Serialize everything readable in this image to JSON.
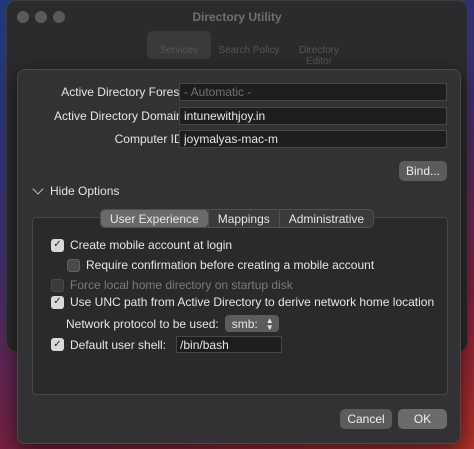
{
  "background_window": {
    "title": "Directory Utility",
    "toolbar": [
      "Services",
      "Search Policy",
      "Directory Editor"
    ]
  },
  "form": {
    "forest_label": "Active Directory Forest:",
    "forest_placeholder": "- Automatic -",
    "domain_label": "Active Directory Domain:",
    "domain_value": "intunewithjoy.in",
    "computer_label": "Computer ID:",
    "computer_value": "joymalyas-mac-m",
    "bind_button": "Bind..."
  },
  "options": {
    "toggle_label": "Hide Options",
    "tabs": [
      "User Experience",
      "Mappings",
      "Administrative"
    ],
    "create_mobile": "Create mobile account at login",
    "require_confirm": "Require confirmation before creating a mobile account",
    "force_local": "Force local home directory on startup disk",
    "use_unc": "Use UNC path from Active Directory to derive network home location",
    "protocol_label": "Network protocol to be used:",
    "protocol_value": "smb:",
    "shell_label": "Default user shell:",
    "shell_value": "/bin/bash"
  },
  "buttons": {
    "cancel": "Cancel",
    "ok": "OK"
  }
}
